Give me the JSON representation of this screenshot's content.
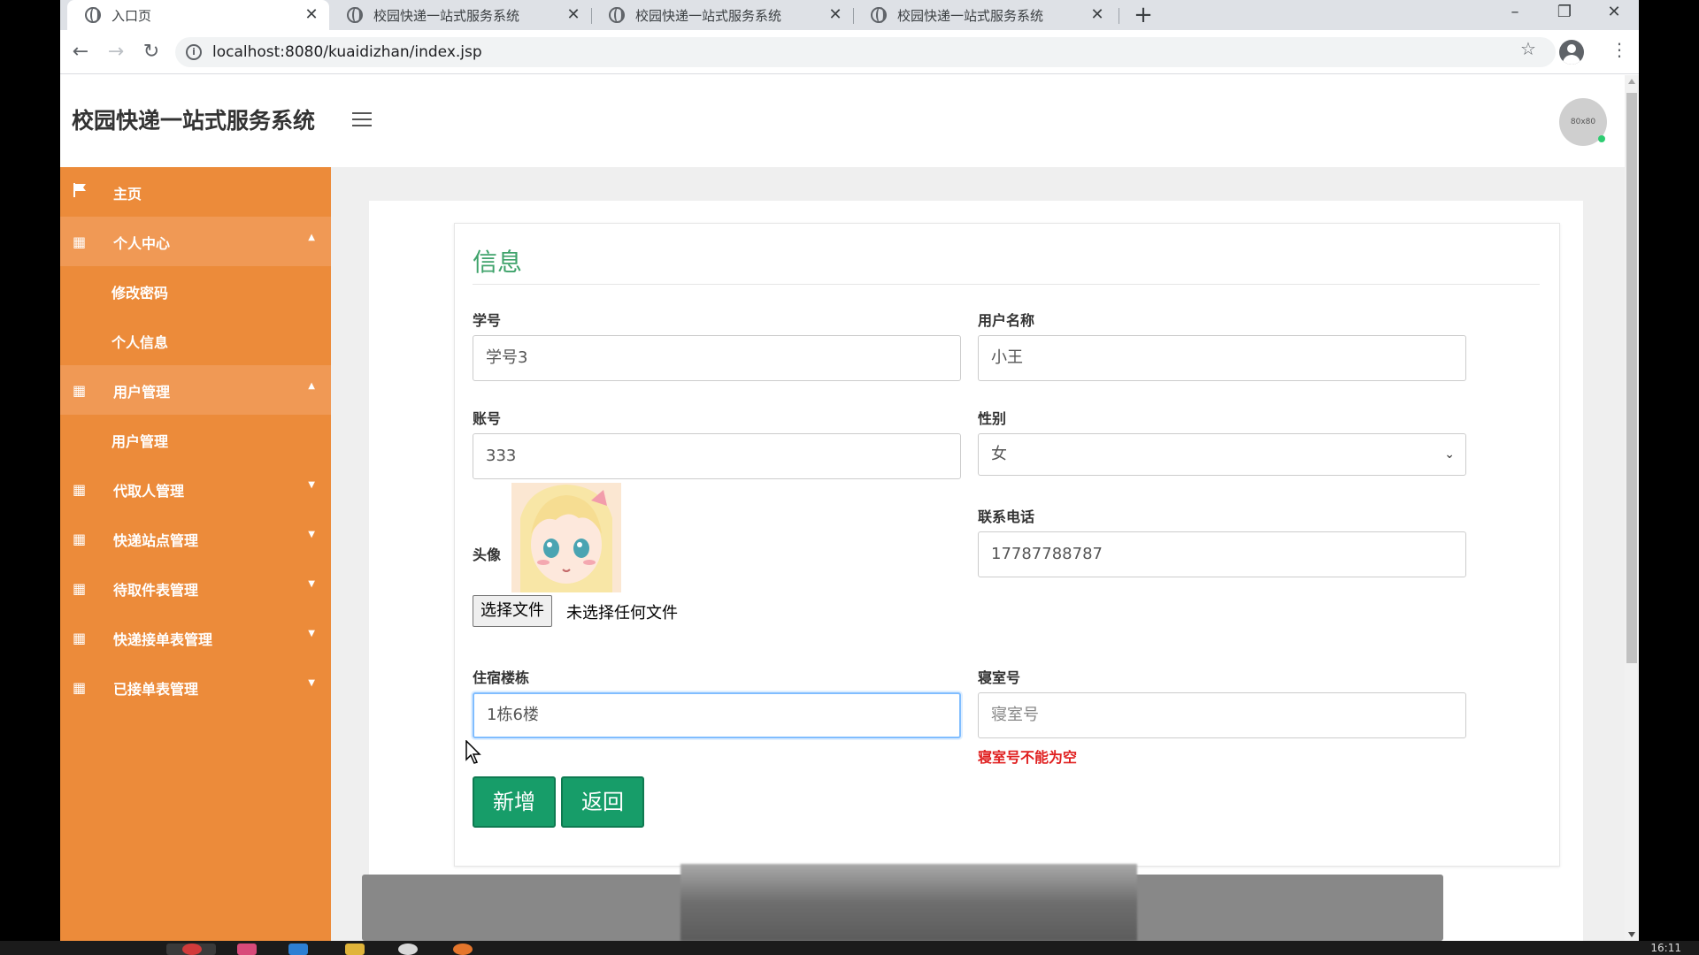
{
  "browser": {
    "tabs": [
      {
        "title": "入口页",
        "active": true
      },
      {
        "title": "校园快递一站式服务系统",
        "active": false
      },
      {
        "title": "校园快递一站式服务系统",
        "active": false
      },
      {
        "title": "校园快递一站式服务系统",
        "active": false
      }
    ],
    "url": "localhost:8080/kuaidizhan/index.jsp",
    "window_buttons": {
      "minimize": "–",
      "restore": "❐",
      "close": "✕"
    }
  },
  "app": {
    "title": "校园快递一站式服务系统",
    "avatar_text": "80x80"
  },
  "sidebar": {
    "home": "主页",
    "groups": [
      {
        "label": "个人中心",
        "open": true,
        "children": [
          "修改密码",
          "个人信息"
        ]
      },
      {
        "label": "用户管理",
        "open": true,
        "children": [
          "用户管理"
        ]
      },
      {
        "label": "代取人管理",
        "open": false
      },
      {
        "label": "快递站点管理",
        "open": false
      },
      {
        "label": "待取件表管理",
        "open": false
      },
      {
        "label": "快递接单表管理",
        "open": false
      },
      {
        "label": "已接单表管理",
        "open": false
      }
    ]
  },
  "form": {
    "title": "信息",
    "student_id": {
      "label": "学号",
      "value": "学号3"
    },
    "username": {
      "label": "用户名称",
      "value": "小王"
    },
    "account": {
      "label": "账号",
      "value": "333"
    },
    "gender": {
      "label": "性别",
      "value": "女"
    },
    "avatar": {
      "label": "头像",
      "choose_button": "选择文件",
      "file_status": "未选择任何文件"
    },
    "phone": {
      "label": "联系电话",
      "value": "17787788787"
    },
    "dorm_building": {
      "label": "住宿楼栋",
      "value": "1栋6楼"
    },
    "room_no": {
      "label": "寝室号",
      "placeholder": "寝室号",
      "error": "寝室号不能为空"
    },
    "buttons": {
      "add": "新增",
      "back": "返回"
    }
  },
  "taskbar": {
    "time": "16:11"
  },
  "colors": {
    "sidebar": "#ec8b3a",
    "accent_green": "#179d69",
    "title_green": "#3fa36b",
    "error": "#e02020"
  }
}
